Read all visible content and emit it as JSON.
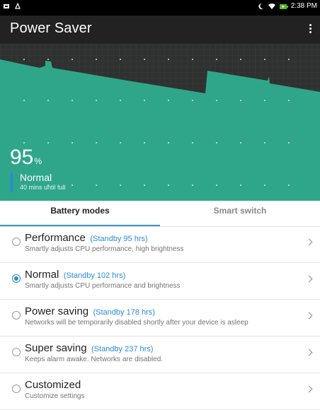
{
  "status_bar": {
    "time": "2:38 PM",
    "icons": [
      "screenshot-icon",
      "notification-icon",
      "moon-icon",
      "wifi-icon",
      "battery-charging-icon"
    ]
  },
  "app_bar": {
    "title": "Power Saver",
    "menu_icon": "overflow-menu-icon"
  },
  "battery": {
    "percent": "95",
    "percent_unit": "%",
    "mode": "Normal",
    "time_to_full": "40 mins until full"
  },
  "tabs": [
    {
      "label": "Battery modes",
      "active": true
    },
    {
      "label": "Smart switch",
      "active": false
    }
  ],
  "modes": [
    {
      "name": "Performance",
      "standby": "(Standby 95 hrs)",
      "description": "Smartly adjusts CPU performance, high brightness",
      "selected": false
    },
    {
      "name": "Normal",
      "standby": "(Standby 102 hrs)",
      "description": "Smartly adjusts CPU performance and brightness",
      "selected": true
    },
    {
      "name": "Power saving",
      "standby": "(Standby 178 hrs)",
      "description": "Networks will be temporarily disabled shortly after your device is asleep",
      "selected": false
    },
    {
      "name": "Super saving",
      "standby": "(Standby 237 hrs)",
      "description": "Keeps alarm awake. Networks are disabled.",
      "selected": false
    },
    {
      "name": "Customized",
      "standby": "",
      "description": "Customize settings",
      "selected": false
    }
  ],
  "colors": {
    "accent": "#2a8ad8",
    "chart_fill": "#2fa68a",
    "chart_bg": "#2f3030",
    "app_bar": "#222222"
  }
}
